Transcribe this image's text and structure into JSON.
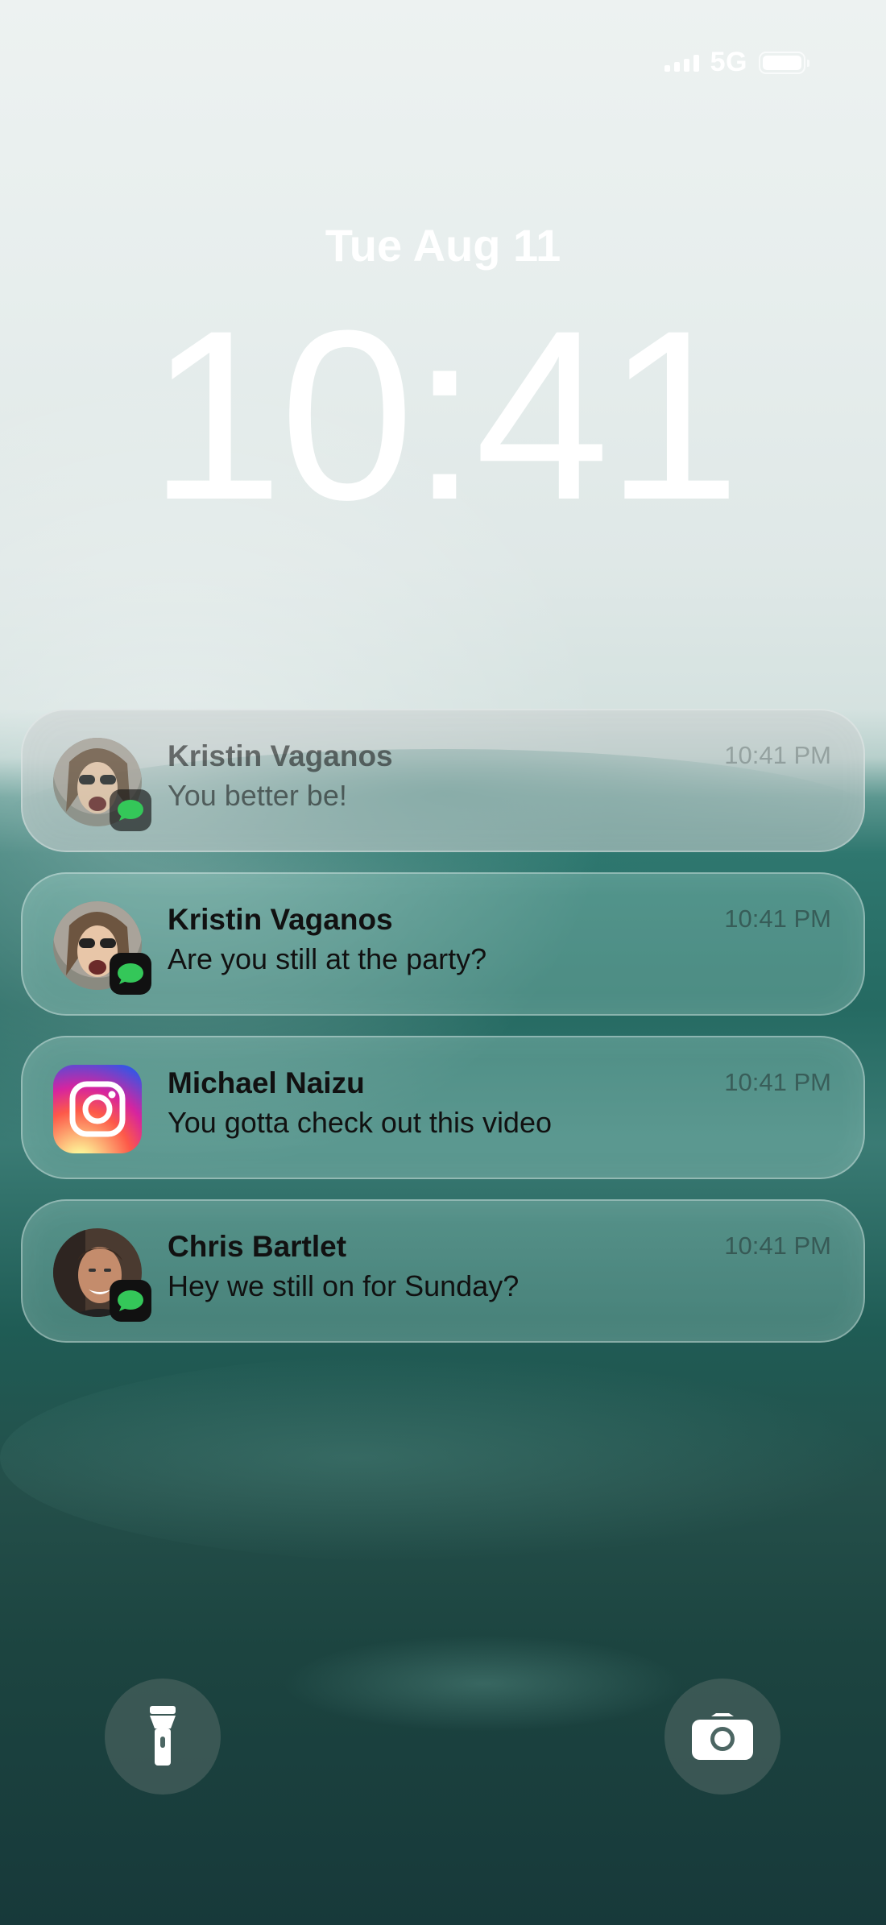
{
  "status_bar": {
    "network": "5G",
    "signal_icon": "cellular-signal-icon",
    "battery_icon": "battery-icon"
  },
  "lock_screen": {
    "date": "Tue Aug 11",
    "time": "10:41"
  },
  "notifications": [
    {
      "sender": "Kristin Vaganos",
      "message": "You better be!",
      "time": "10:41 PM",
      "app": "messages",
      "state": "faded"
    },
    {
      "sender": "Kristin Vaganos",
      "message": "Are you still at the party?",
      "time": "10:41 PM",
      "app": "messages"
    },
    {
      "sender": "Michael Naizu",
      "message": "You gotta check out this video",
      "time": "10:41 PM",
      "app": "instagram"
    },
    {
      "sender": "Chris Bartlet",
      "message": "Hey we still on for Sunday?",
      "time": "10:41 PM",
      "app": "messages"
    }
  ],
  "quick_actions": {
    "left": "flashlight-icon",
    "right": "camera-icon"
  },
  "colors": {
    "messages_green": "#34c759",
    "instagram_gradient": [
      "#fdf497",
      "#fd5949",
      "#d6249f",
      "#285AEB"
    ]
  }
}
